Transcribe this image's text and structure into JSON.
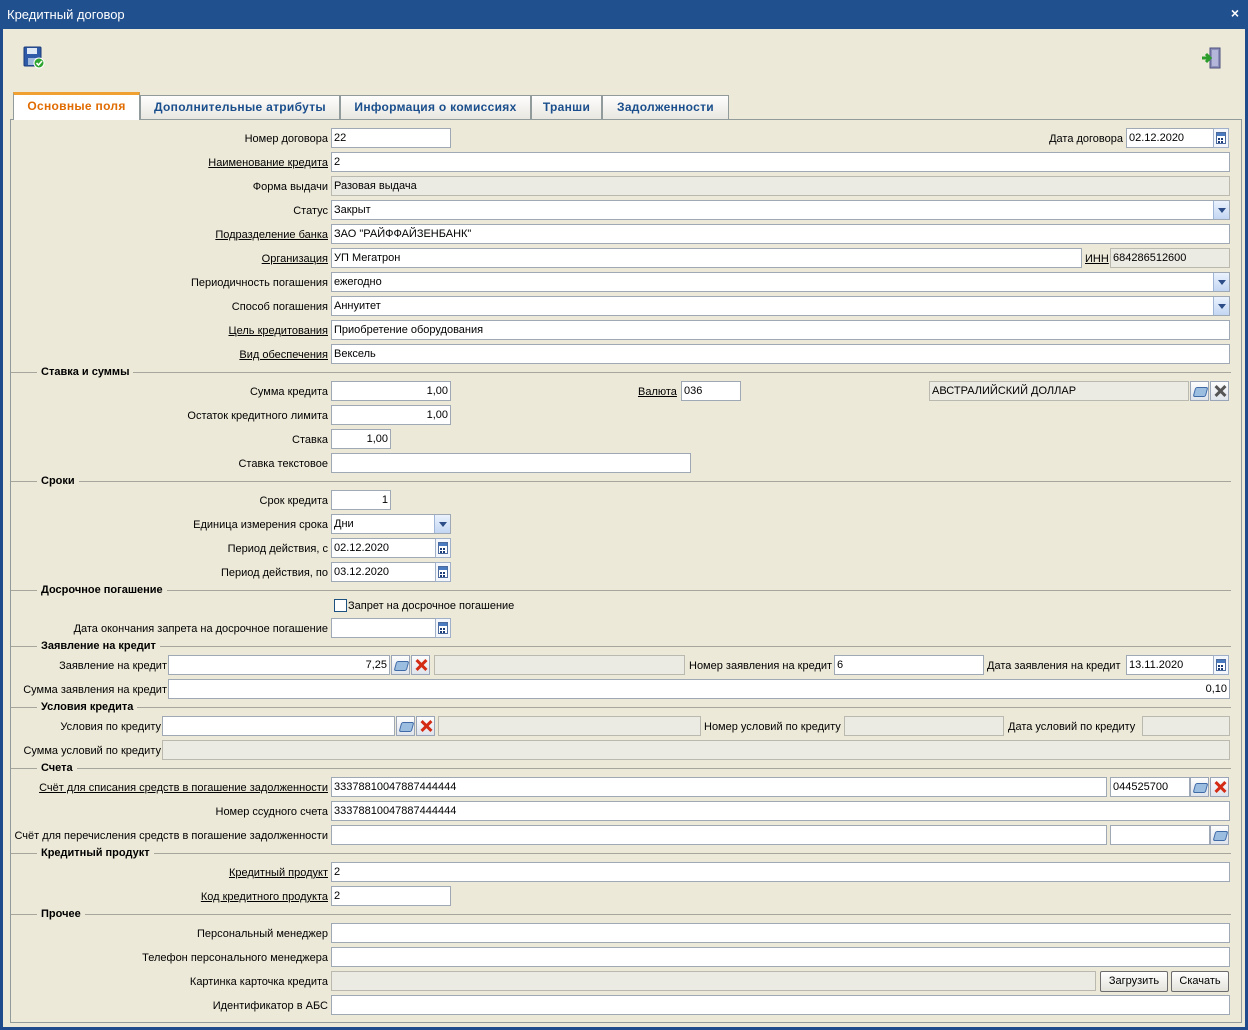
{
  "window": {
    "title": "Кредитный договор",
    "close": "×"
  },
  "toolbar": {
    "save_icon": "save-disk-icon",
    "exit_icon": "exit-door-icon"
  },
  "tabs": [
    "Основные поля",
    "Дополнительные атрибуты",
    "Информация о комиссиях",
    "Транши",
    "Задолженности"
  ],
  "main": {
    "contract_number_label": "Номер договора",
    "contract_number": "22",
    "contract_date_label": "Дата договора",
    "contract_date": "02.12.2020",
    "credit_name_label": "Наименование кредита",
    "credit_name": "2",
    "issue_form_label": "Форма выдачи",
    "issue_form": "Разовая выдача",
    "status_label": "Статус",
    "status": "Закрыт",
    "bank_division_label": "Подразделение банка",
    "bank_division": "ЗАО \"РАЙФФАЙЗЕНБАНК\"",
    "organization_label": "Организация",
    "organization": "УП Мегатрон",
    "inn_label": "ИНН",
    "inn": "684286512600",
    "repay_period_label": "Периодичность погашения",
    "repay_period": "ежегодно",
    "repay_method_label": "Способ погашения",
    "repay_method": "Аннуитет",
    "purpose_label": "Цель кредитования",
    "purpose": "Приобретение оборудования",
    "collateral_label": "Вид обеспечения",
    "collateral": "Вексель"
  },
  "rates": {
    "section": "Ставка и суммы",
    "amount_label": "Сумма кредита",
    "amount": "1,00",
    "currency_label": "Валюта",
    "currency_code": "036",
    "currency_name": "АВСТРАЛИЙСКИЙ ДОЛЛАР",
    "limit_rest_label": "Остаток кредитного лимита",
    "limit_rest": "1,00",
    "rate_label": "Ставка",
    "rate": "1,00",
    "rate_text_label": "Ставка текстовое",
    "rate_text": ""
  },
  "terms": {
    "section": "Сроки",
    "term_label": "Срок кредита",
    "term": "1",
    "unit_label": "Единица измерения срока",
    "unit": "Дни",
    "from_label": "Период действия, с",
    "from": "02.12.2020",
    "to_label": "Период действия, по",
    "to": "03.12.2020"
  },
  "early": {
    "section": "Досрочное погашение",
    "ban_label": "Запрет на досрочное погашение",
    "ban_end_label": "Дата окончания запрета на досрочное погашение",
    "ban_end": ""
  },
  "application": {
    "section": "Заявление на кредит",
    "app_label": "Заявление на кредит",
    "app_value": "7,25",
    "app_number_label": "Номер заявления на кредит",
    "app_number": "6",
    "app_date_label": "Дата заявления на кредит",
    "app_date": "13.11.2020",
    "app_sum_label": "Сумма заявления на кредит",
    "app_sum": "0,10"
  },
  "conditions": {
    "section": "Условия кредита",
    "cond_label": "Условия по кредиту",
    "cond_value": "",
    "cond_number_label": "Номер условий по кредиту",
    "cond_number": "",
    "cond_date_label": "Дата условий по кредиту",
    "cond_date": "",
    "cond_sum_label": "Сумма условий по кредиту",
    "cond_sum": ""
  },
  "accounts": {
    "section": "Счета",
    "debit_label": "Счёт для списания средств в погашение задолженности",
    "debit": "33378810047887444444",
    "debit_bik": "044525700",
    "loan_label": "Номер ссудного счета",
    "loan": "33378810047887444444",
    "transfer_label": "Счёт для перечисления средств в погашение задолженности",
    "transfer": "",
    "transfer_bik": ""
  },
  "product": {
    "section": "Кредитный продукт",
    "product_label": "Кредитный продукт",
    "product": "2",
    "code_label": "Код кредитного продукта",
    "code": "2"
  },
  "other": {
    "section": "Прочее",
    "manager_label": "Персональный менеджер",
    "manager": "",
    "phone_label": "Телефон персонального менеджера",
    "phone": "",
    "card_label": "Картинка карточка кредита",
    "card": "",
    "upload": "Загрузить",
    "download": "Скачать",
    "abs_label": "Идентификатор в АБС",
    "abs": ""
  }
}
